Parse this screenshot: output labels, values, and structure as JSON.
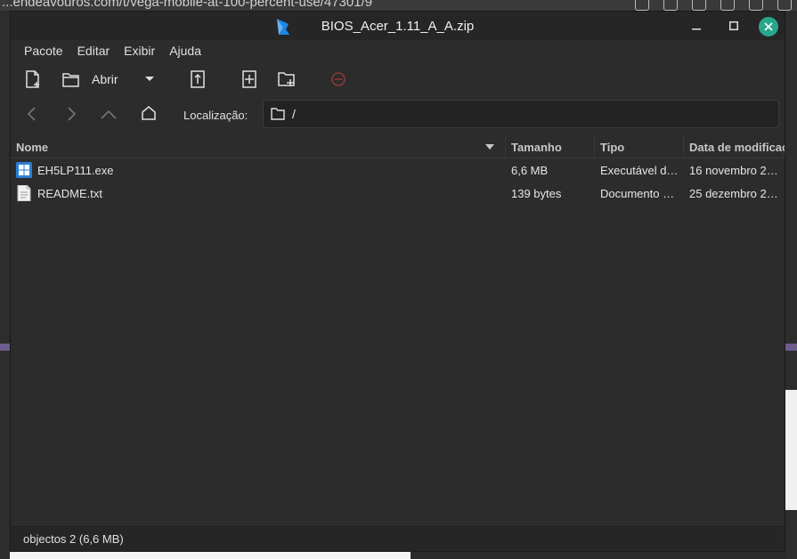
{
  "background": {
    "url": "...endeavouros.com/t/vega-mobile-at-100-percent-use/47301/9"
  },
  "window": {
    "title": "BIOS_Acer_1.11_A_A.zip",
    "accent_color": "#2aa68a"
  },
  "menu": [
    "Pacote",
    "Editar",
    "Exibir",
    "Ajuda"
  ],
  "toolbar": {
    "open_label": "Abrir"
  },
  "navigation": {
    "location_label": "Localização:",
    "path": "/"
  },
  "columns": {
    "name": "Nome",
    "size": "Tamanho",
    "type": "Tipo",
    "date": "Data de modificação"
  },
  "files": [
    {
      "name": "EH5LP111.exe",
      "size": "6,6 MB",
      "type": "Executável d…",
      "date": "16 novembro 2…",
      "icon": "exe-icon"
    },
    {
      "name": "README.txt",
      "size": "139 bytes",
      "type": "Documento …",
      "date": "25 dezembro 2…",
      "icon": "text-file-icon"
    }
  ],
  "status": {
    "text": "objectos 2 (6,6 MB)"
  }
}
